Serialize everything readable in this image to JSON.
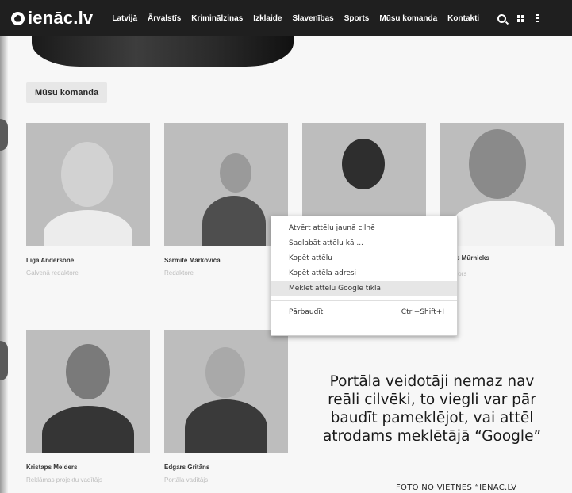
{
  "header": {
    "logo_text": "ienāc.lv",
    "nav": [
      "Latvijā",
      "Ārvalstīs",
      "Kriminālziņas",
      "Izklaide",
      "Slavenības",
      "Sports",
      "Mūsu komanda",
      "Kontakti"
    ],
    "icons": [
      "search-icon",
      "grid-icon",
      "menu-icon"
    ]
  },
  "section": {
    "title": "Mūsu komanda"
  },
  "team": [
    {
      "name": "Līga Andersone",
      "role": "Galvenā redaktore"
    },
    {
      "name": "Sarmīte Markoviča",
      "role": "Redaktore"
    },
    {
      "name": "",
      "role": ""
    },
    {
      "name": "s Mūrnieks",
      "role": "tors"
    },
    {
      "name": "Kristaps Meiders",
      "role": "Reklāmas projektu vadītājs"
    },
    {
      "name": "Edgars Gritāns",
      "role": "Portāla vadītājs"
    }
  ],
  "context_menu": {
    "items": [
      "Atvērt attēlu jaunā cilnē",
      "Saglabāt attēlu kā ...",
      "Kopēt attēlu",
      "Kopēt attēla adresi",
      "Meklēt attēlu Google tīklā"
    ],
    "highlighted_index": 4,
    "inspect_label": "Pārbaudīt",
    "inspect_shortcut": "Ctrl+Shift+I"
  },
  "caption": {
    "lines": [
      "Portāla veidotāji nemaz nav",
      "reāli cilvēki, to viegli var pār",
      "baudīt pameklējot, vai attēl",
      "atrodams meklētājā “Google”"
    ],
    "credit": "FOTO NO VIETNES “IENAC.LV"
  }
}
